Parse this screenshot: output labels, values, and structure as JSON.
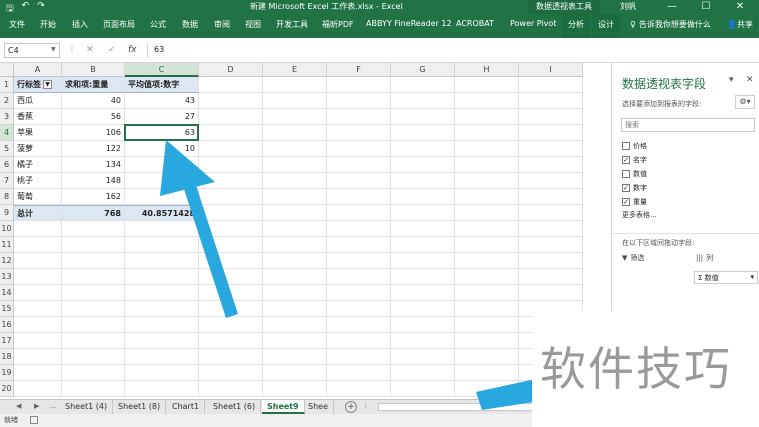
{
  "titlebar": {
    "quick_icons": [
      "save-icon",
      "undo-icon",
      "redo-icon"
    ],
    "title": "新建 Microsoft Excel 工作表.xlsx  -  Excel",
    "context_tab": "数据透视表工具",
    "user": "刘帆",
    "window_controls": [
      "—",
      "☐",
      "✕"
    ]
  },
  "ribbon": {
    "tabs": [
      "文件",
      "开始",
      "插入",
      "页面布局",
      "公式",
      "数据",
      "审阅",
      "视图",
      "开发工具",
      "福昕PDF",
      "ABBYY FineReader 12",
      "ACROBAT",
      "Power Pivot",
      "分析",
      "设计"
    ],
    "tell_me": "告诉我你想要做什么",
    "share": "共享"
  },
  "formula_bar": {
    "name_box": "C4",
    "cancel": "✕",
    "enter": "✓",
    "fx": "fx",
    "value": "63"
  },
  "grid": {
    "columns": [
      "A",
      "B",
      "C",
      "D",
      "E",
      "F",
      "G",
      "H",
      "I"
    ],
    "rows": [
      "1",
      "2",
      "3",
      "4",
      "5",
      "6",
      "7",
      "8",
      "9",
      "10",
      "11",
      "12",
      "13",
      "14",
      "15",
      "16",
      "17",
      "18",
      "19",
      "20"
    ],
    "headers": [
      "行标签",
      "求和项:重量",
      "平均值项:数字"
    ],
    "data": [
      [
        "西瓜",
        "40",
        "43"
      ],
      [
        "香蕉",
        "56",
        "27"
      ],
      [
        "苹果",
        "106",
        "63"
      ],
      [
        "菠萝",
        "122",
        "10"
      ],
      [
        "橘子",
        "134",
        ""
      ],
      [
        "桃子",
        "148",
        ""
      ],
      [
        "葡萄",
        "162",
        ""
      ]
    ],
    "total": [
      "总计",
      "768",
      "40.8571428"
    ],
    "active_cell": "C4"
  },
  "pivot_panel": {
    "title": "数据透视表字段",
    "subtitle": "选择要添加到报表的字段:",
    "search_placeholder": "搜索",
    "fields": [
      {
        "name": "价格",
        "checked": false
      },
      {
        "name": "名字",
        "checked": true
      },
      {
        "name": "数值",
        "checked": false
      },
      {
        "name": "数字",
        "checked": true
      },
      {
        "name": "重量",
        "checked": true
      }
    ],
    "more_tables": "更多表格...",
    "drag_hint": "在以下区域间拖动字段:",
    "filters_label": "筛选",
    "columns_label": "列",
    "values_item": "数值"
  },
  "sheets": {
    "tabs": [
      "Sheet1 (4)",
      "Sheet1 (8)",
      "Chart1",
      "Sheet1 (6)",
      "Sheet9",
      "Shee"
    ],
    "active": "Sheet9"
  },
  "status": {
    "text": "就绪"
  },
  "watermark": {
    "text": "软件技巧"
  },
  "colors": {
    "excel_green": "#217346",
    "pivot_header": "#dde6f3",
    "arrow": "#29a8e0"
  }
}
